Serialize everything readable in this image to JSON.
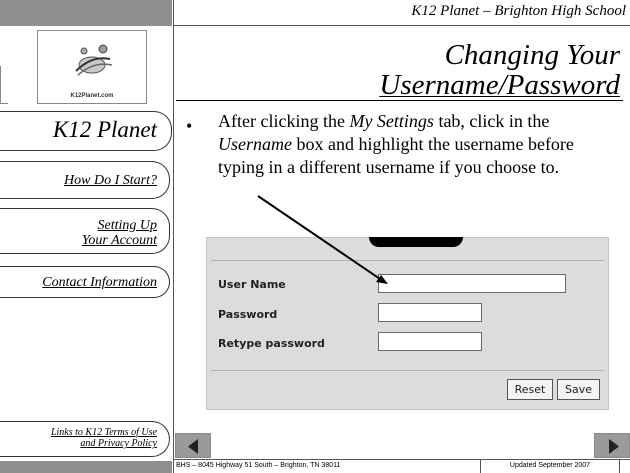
{
  "header": {
    "school": "K12 Planet – Brighton High School"
  },
  "logo": {
    "text": "K12Planet.com"
  },
  "sidebar": {
    "brand": "K12 Planet",
    "items": [
      {
        "label": "How Do I Start?"
      },
      {
        "label_line1": "Setting Up",
        "label_line2": "Your Account"
      },
      {
        "label": "Contact Information"
      }
    ],
    "policy_line1": "Links to K12 Terms of Use",
    "policy_line2": "and Privacy Policy"
  },
  "slide": {
    "title_line1": "Changing Your",
    "title_line2": "Username/Password",
    "bullet": "•",
    "text_1": "After clicking the ",
    "text_2": "My Settings",
    "text_3": " tab, click in the ",
    "text_4": "Username",
    "text_5": " box and highlight the username before typing in a different username if you choose to."
  },
  "form": {
    "username_label": "User Name",
    "password_label": "Password",
    "retype_label": "Retype password",
    "username_value": "",
    "password_value": "",
    "retype_value": "",
    "reset_label": "Reset",
    "save_label": "Save"
  },
  "footer": {
    "address": "BHS – 8045 Highway 51 South – Brighton, TN 38011",
    "updated": "Updated September 2007"
  },
  "colors": {
    "band": "#8e8e8e",
    "panel": "#dcdcdc"
  },
  "icons": {
    "prev": "triangle-left-icon",
    "next": "triangle-right-icon"
  }
}
